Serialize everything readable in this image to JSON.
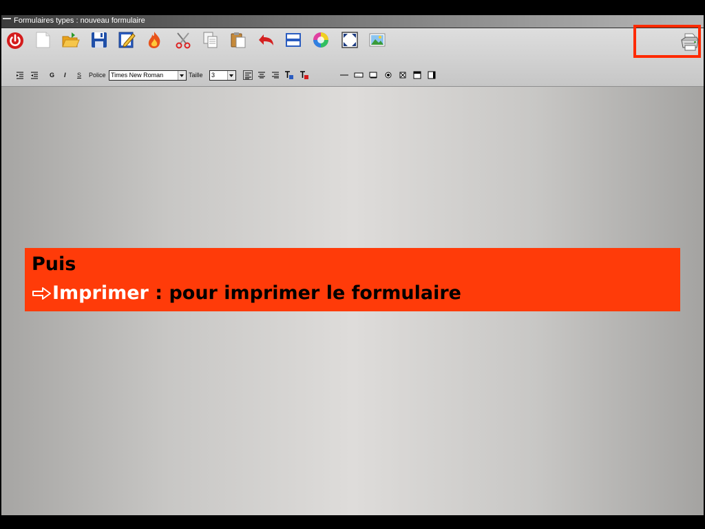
{
  "window": {
    "title": "Formulaires types : nouveau formulaire"
  },
  "toolbar": {
    "icons": [
      "power-icon",
      "new-document-icon",
      "open-folder-icon",
      "save-icon",
      "edit-icon",
      "fire-icon",
      "cut-icon",
      "copy-icon",
      "paste-icon",
      "undo-icon",
      "layout-icon",
      "color-icon",
      "fullscreen-icon",
      "image-icon",
      "printer-icon"
    ]
  },
  "format_bar": {
    "bold_label": "G",
    "italic_label": "I",
    "strike_label": "S",
    "font_label": "Police",
    "font_value": "Times New Roman",
    "size_label": "Taille",
    "size_value": "3"
  },
  "callout": {
    "line1": "Puis",
    "action": "Imprimer",
    "description": " : pour imprimer le formulaire"
  },
  "colors": {
    "callout_bg": "#ff3b09",
    "highlight_border": "#ff2a00",
    "action_text": "#ffffff"
  }
}
